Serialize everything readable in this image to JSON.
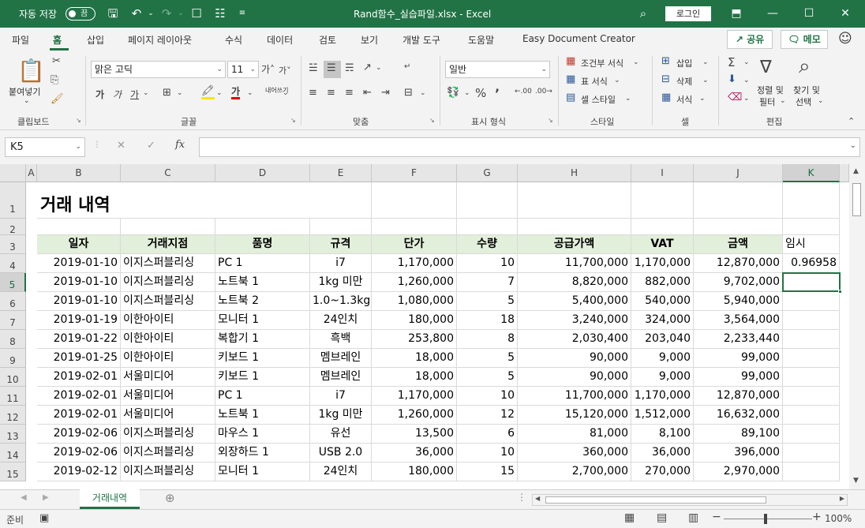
{
  "titlebar": {
    "autosave_label": "자동 저장",
    "autosave_state": "끔",
    "filename": "Rand함수_실습파일.xlsx  -  Excel",
    "login": "로그인"
  },
  "menu": {
    "tabs": [
      "파일",
      "홈",
      "삽입",
      "페이지 레이아웃",
      "수식",
      "데이터",
      "검토",
      "보기",
      "개발 도구",
      "도움말",
      "Easy Document Creator"
    ],
    "active": "홈",
    "share": "공유",
    "memo": "메모"
  },
  "ribbon": {
    "clipboard": {
      "paste": "붙여넣기",
      "label": "클립보드"
    },
    "font": {
      "name": "맑은 고딕",
      "size": "11",
      "label": "글꼴",
      "bold": "가",
      "italic": "가",
      "underline": "가",
      "fontcolor": "가"
    },
    "align": {
      "label": "맞춤",
      "wrap": "내어쓰기"
    },
    "number": {
      "format": "일반",
      "label": "표시 형식"
    },
    "styles": {
      "conditional": "조건부 서식",
      "table": "표 서식",
      "cell": "셀 스타일",
      "label": "스타일"
    },
    "cells": {
      "insert": "삽입",
      "delete": "삭제",
      "format": "서식",
      "label": "셀"
    },
    "editing": {
      "sort_1": "정렬 및",
      "sort_2": "필터",
      "find_1": "찾기 및",
      "find_2": "선택",
      "label": "편집"
    }
  },
  "formula": {
    "namebox": "K5",
    "content": ""
  },
  "grid": {
    "columns": [
      "A",
      "B",
      "C",
      "D",
      "E",
      "F",
      "G",
      "H",
      "I",
      "J",
      "K"
    ],
    "selected_col": "K",
    "selected_row": "5",
    "title": "거래 내역",
    "headers": [
      "일자",
      "거래지점",
      "품명",
      "규격",
      "단가",
      "수량",
      "공급가액",
      "VAT",
      "금액"
    ],
    "k3": "임시",
    "rows": [
      {
        "num": "4",
        "date": "2019-01-10",
        "branch": "이지스퍼블리싱",
        "item": "PC 1",
        "spec": "i7",
        "price": "1,170,000",
        "qty": "10",
        "supply": "11,700,000",
        "vat": "1,170,000",
        "amount": "12,870,000",
        "k": "0.96958"
      },
      {
        "num": "5",
        "date": "2019-01-10",
        "branch": "이지스퍼블리싱",
        "item": "노트북 1",
        "spec": "1kg 미만",
        "price": "1,260,000",
        "qty": "7",
        "supply": "8,820,000",
        "vat": "882,000",
        "amount": "9,702,000",
        "k": ""
      },
      {
        "num": "6",
        "date": "2019-01-10",
        "branch": "이지스퍼블리싱",
        "item": "노트북 2",
        "spec": "1.0~1.3kg",
        "price": "1,080,000",
        "qty": "5",
        "supply": "5,400,000",
        "vat": "540,000",
        "amount": "5,940,000",
        "k": ""
      },
      {
        "num": "7",
        "date": "2019-01-19",
        "branch": "이한아이티",
        "item": "모니터 1",
        "spec": "24인치",
        "price": "180,000",
        "qty": "18",
        "supply": "3,240,000",
        "vat": "324,000",
        "amount": "3,564,000",
        "k": ""
      },
      {
        "num": "8",
        "date": "2019-01-22",
        "branch": "이한아이티",
        "item": "복합기 1",
        "spec": "흑백",
        "price": "253,800",
        "qty": "8",
        "supply": "2,030,400",
        "vat": "203,040",
        "amount": "2,233,440",
        "k": ""
      },
      {
        "num": "9",
        "date": "2019-01-25",
        "branch": "이한아이티",
        "item": "키보드 1",
        "spec": "멤브레인",
        "price": "18,000",
        "qty": "5",
        "supply": "90,000",
        "vat": "9,000",
        "amount": "99,000",
        "k": ""
      },
      {
        "num": "10",
        "date": "2019-02-01",
        "branch": "서울미디어",
        "item": "키보드 1",
        "spec": "멤브레인",
        "price": "18,000",
        "qty": "5",
        "supply": "90,000",
        "vat": "9,000",
        "amount": "99,000",
        "k": ""
      },
      {
        "num": "11",
        "date": "2019-02-01",
        "branch": "서울미디어",
        "item": "PC 1",
        "spec": "i7",
        "price": "1,170,000",
        "qty": "10",
        "supply": "11,700,000",
        "vat": "1,170,000",
        "amount": "12,870,000",
        "k": ""
      },
      {
        "num": "12",
        "date": "2019-02-01",
        "branch": "서울미디어",
        "item": "노트북 1",
        "spec": "1kg 미만",
        "price": "1,260,000",
        "qty": "12",
        "supply": "15,120,000",
        "vat": "1,512,000",
        "amount": "16,632,000",
        "k": ""
      },
      {
        "num": "13",
        "date": "2019-02-06",
        "branch": "이지스퍼블리싱",
        "item": "마우스 1",
        "spec": "유선",
        "price": "13,500",
        "qty": "6",
        "supply": "81,000",
        "vat": "8,100",
        "amount": "89,100",
        "k": ""
      },
      {
        "num": "14",
        "date": "2019-02-06",
        "branch": "이지스퍼블리싱",
        "item": "외장하드 1",
        "spec": "USB 2.0",
        "price": "36,000",
        "qty": "10",
        "supply": "360,000",
        "vat": "36,000",
        "amount": "396,000",
        "k": ""
      },
      {
        "num": "15",
        "date": "2019-02-12",
        "branch": "이지스퍼블리싱",
        "item": "모니터 1",
        "spec": "24인치",
        "price": "180,000",
        "qty": "15",
        "supply": "2,700,000",
        "vat": "270,000",
        "amount": "2,970,000",
        "k": ""
      }
    ]
  },
  "sheet_tabs": {
    "active": "거래내역"
  },
  "status": {
    "mode": "준비",
    "zoom": "100%"
  },
  "colors": {
    "excel_green": "#217346",
    "header_fill": "#e2efda"
  }
}
